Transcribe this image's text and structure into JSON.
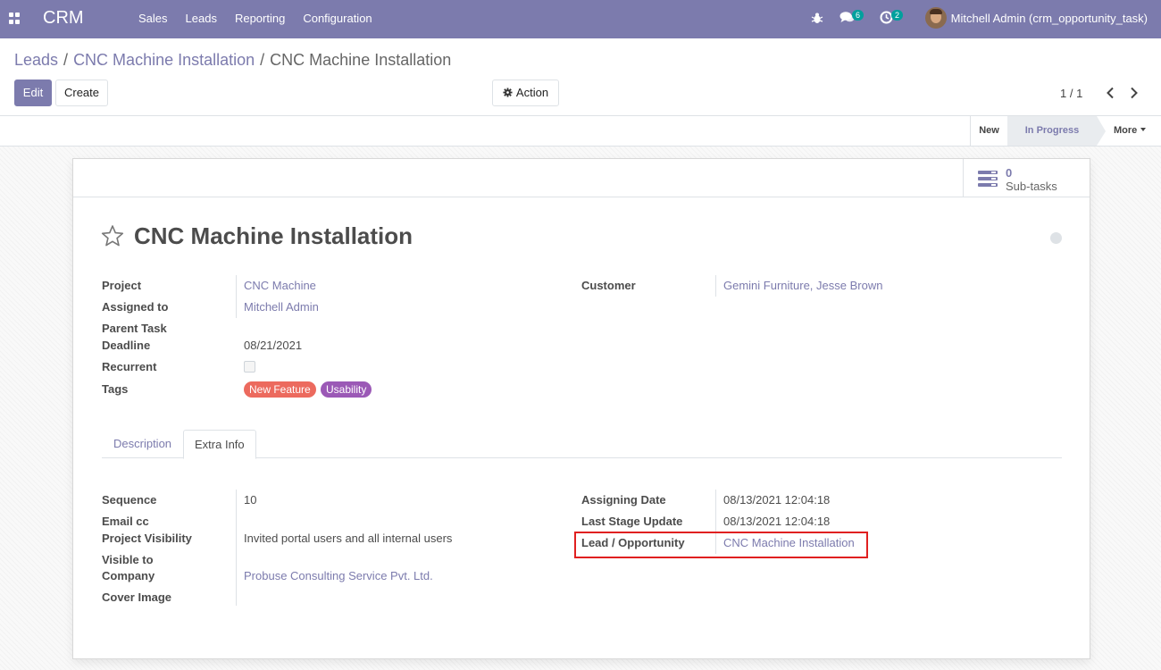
{
  "navbar": {
    "brand": "CRM",
    "menu": [
      "Sales",
      "Leads",
      "Reporting",
      "Configuration"
    ],
    "messages_count": "6",
    "activities_count": "2",
    "user": "Mitchell Admin (crm_opportunity_task)"
  },
  "breadcrumb": {
    "items": [
      "Leads",
      "CNC Machine Installation"
    ],
    "current": "CNC Machine Installation"
  },
  "control": {
    "edit_label": "Edit",
    "create_label": "Create",
    "action_label": "Action",
    "pager": "1 / 1"
  },
  "statusbar": {
    "stages": [
      "New",
      "In Progress"
    ],
    "active_stage": "In Progress",
    "more_label": "More"
  },
  "smart_button": {
    "count": "0",
    "label": "Sub-tasks"
  },
  "task": {
    "title": "CNC Machine Installation",
    "fields_left": {
      "project_label": "Project",
      "project": "CNC Machine",
      "assigned_label": "Assigned to",
      "assigned": "Mitchell Admin",
      "parent_label": "Parent Task",
      "deadline_label": "Deadline",
      "deadline": "08/21/2021",
      "recurrent_label": "Recurrent",
      "tags_label": "Tags"
    },
    "tags": [
      {
        "name": "New Feature",
        "color": "#ec6a5e"
      },
      {
        "name": "Usability",
        "color": "#9b59b6"
      }
    ],
    "fields_right": {
      "customer_label": "Customer",
      "customer": "Gemini Furniture, Jesse Brown"
    }
  },
  "tabs": [
    "Description",
    "Extra Info"
  ],
  "extra_info": {
    "sequence_label": "Sequence",
    "sequence": "10",
    "email_cc_label": "Email cc",
    "visibility_label": "Project Visibility",
    "visibility": "Invited portal users and all internal users",
    "visible_to_label": "Visible to",
    "company_label": "Company",
    "company": "Probuse Consulting Service Pvt. Ltd.",
    "cover_label": "Cover Image",
    "assigning_date_label": "Assigning Date",
    "assigning_date": "08/13/2021 12:04:18",
    "last_stage_label": "Last Stage Update",
    "last_stage": "08/13/2021 12:04:18",
    "lead_label": "Lead / Opportunity",
    "lead": "CNC Machine Installation"
  },
  "colors": {
    "brand": "#7c7bad",
    "highlight": "#e02020",
    "badge": "#00a09d"
  }
}
